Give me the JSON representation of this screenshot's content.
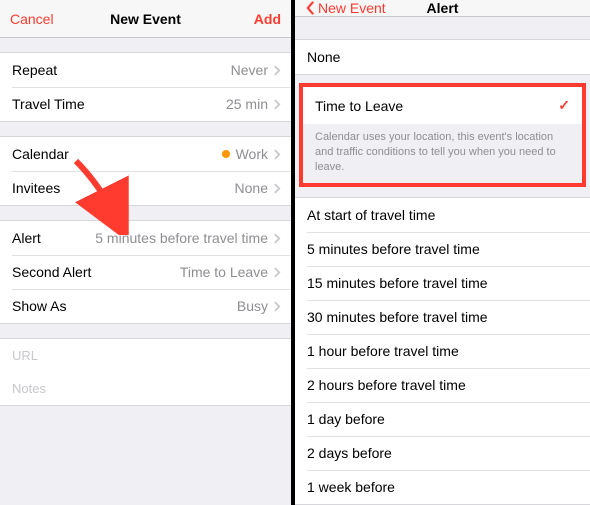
{
  "left": {
    "nav": {
      "cancel": "Cancel",
      "title": "New Event",
      "add": "Add"
    },
    "rows": {
      "repeat": {
        "label": "Repeat",
        "value": "Never"
      },
      "travel_time": {
        "label": "Travel Time",
        "value": "25 min"
      },
      "calendar": {
        "label": "Calendar",
        "value": "Work",
        "dot_color": "#ff9500"
      },
      "invitees": {
        "label": "Invitees",
        "value": "None"
      },
      "alert": {
        "label": "Alert",
        "value": "5 minutes before travel time"
      },
      "second_alert": {
        "label": "Second Alert",
        "value": "Time to Leave"
      },
      "show_as": {
        "label": "Show As",
        "value": "Busy"
      },
      "url": {
        "placeholder": "URL"
      },
      "notes": {
        "placeholder": "Notes"
      }
    }
  },
  "right": {
    "nav": {
      "back": "New Event",
      "title": "Alert"
    },
    "none": "None",
    "selected": {
      "label": "Time to Leave",
      "desc": "Calendar uses your location, this event's location and traffic conditions to tell you when you need to leave."
    },
    "options": [
      "At start of travel time",
      "5 minutes before travel time",
      "15 minutes before travel time",
      "30 minutes before travel time",
      "1 hour before travel time",
      "2 hours before travel time",
      "1 day before",
      "2 days before",
      "1 week before"
    ]
  }
}
